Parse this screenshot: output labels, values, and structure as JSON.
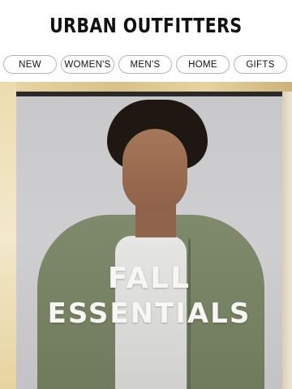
{
  "header": {
    "logo": "URBAN OUTFITTERS"
  },
  "nav": {
    "items": [
      "NEW",
      "WOMEN'S",
      "MEN'S",
      "HOME",
      "GIFTS"
    ]
  },
  "hero": {
    "headline_line1": "FALL",
    "headline_line2": "ESSENTIALS"
  }
}
